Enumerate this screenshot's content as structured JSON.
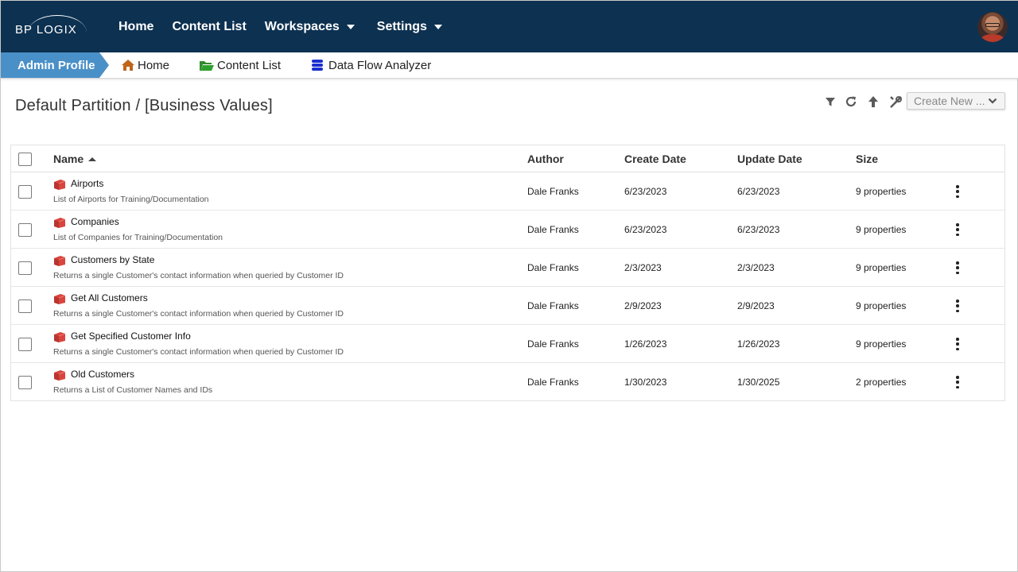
{
  "brand": {
    "logo_text": "BP LOGIX"
  },
  "nav": {
    "items": [
      {
        "label": "Home",
        "has_caret": false
      },
      {
        "label": "Content List",
        "has_caret": false
      },
      {
        "label": "Workspaces",
        "has_caret": true
      },
      {
        "label": "Settings",
        "has_caret": true
      }
    ]
  },
  "tabbar": {
    "admin_profile": "Admin Profile",
    "links": [
      {
        "label": "Home",
        "icon": "home-icon",
        "color": "#c0651a"
      },
      {
        "label": "Content List",
        "icon": "folder-open-icon",
        "color": "#2e8b2e"
      },
      {
        "label": "Data Flow Analyzer",
        "icon": "database-icon",
        "color": "#1a2fd0"
      }
    ]
  },
  "page": {
    "title": "Default Partition / [Business Values]"
  },
  "toolbar": {
    "icons": [
      "filter-icon",
      "refresh-icon",
      "upload-icon",
      "tools-icon"
    ],
    "create_new_label": "Create New ..."
  },
  "table": {
    "columns": [
      "Name",
      "Author",
      "Create Date",
      "Update Date",
      "Size"
    ],
    "sort": {
      "column": "Name",
      "direction": "ascending"
    },
    "rows": [
      {
        "name": "Airports",
        "description": "List of Airports for Training/Documentation",
        "author": "Dale Franks",
        "create_date": "6/23/2023",
        "update_date": "6/23/2023",
        "size": "9 properties"
      },
      {
        "name": "Companies",
        "description": "List of Companies for Training/Documentation",
        "author": "Dale Franks",
        "create_date": "6/23/2023",
        "update_date": "6/23/2023",
        "size": "9 properties"
      },
      {
        "name": "Customers by State",
        "description": "Returns a single Customer's contact information when queried by Customer ID",
        "author": "Dale Franks",
        "create_date": "2/3/2023",
        "update_date": "2/3/2023",
        "size": "9 properties"
      },
      {
        "name": "Get All Customers",
        "description": "Returns a single Customer's contact information when queried by Customer ID",
        "author": "Dale Franks",
        "create_date": "2/9/2023",
        "update_date": "2/9/2023",
        "size": "9 properties"
      },
      {
        "name": "Get Specified Customer Info",
        "description": "Returns a single Customer's contact information when queried by Customer ID",
        "author": "Dale Franks",
        "create_date": "1/26/2023",
        "update_date": "1/26/2023",
        "size": "9 properties"
      },
      {
        "name": "Old Customers",
        "description": "Returns a List of Customer Names and IDs",
        "author": "Dale Franks",
        "create_date": "1/30/2023",
        "update_date": "1/30/2025",
        "size": "2 properties"
      }
    ]
  },
  "colors": {
    "topbar": "#0d3151",
    "admin_profile": "#4a90c8",
    "item_icon": "#d9453d"
  }
}
